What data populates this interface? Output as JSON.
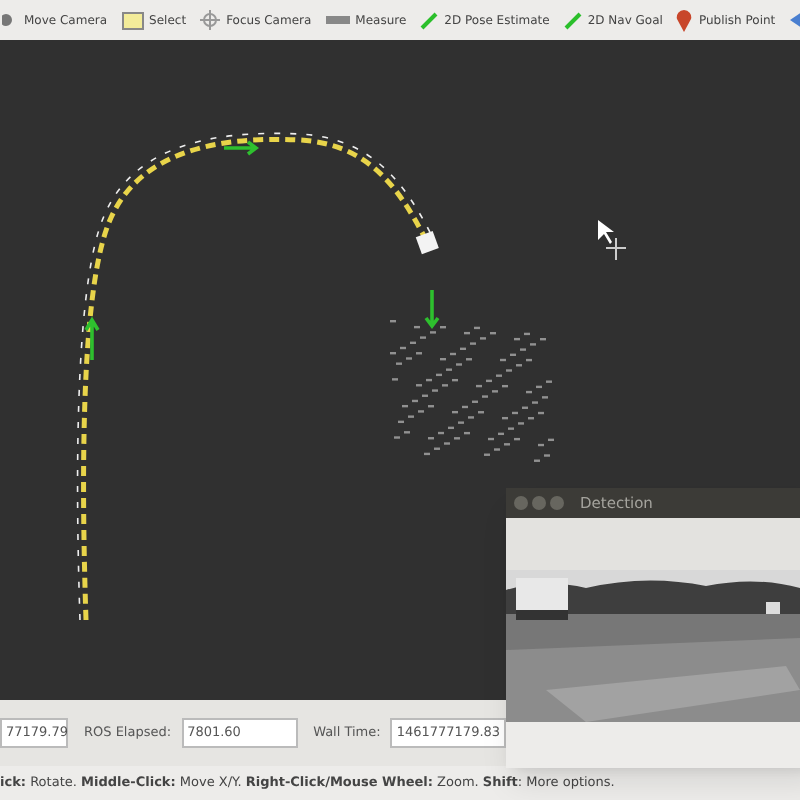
{
  "toolbar": {
    "tools": [
      {
        "kind": "move",
        "label": "Move Camera"
      },
      {
        "kind": "select",
        "label": "Select"
      },
      {
        "kind": "focus",
        "label": "Focus Camera"
      },
      {
        "kind": "measure",
        "label": "Measure"
      },
      {
        "kind": "pose",
        "label": "2D Pose Estimate"
      },
      {
        "kind": "goal",
        "label": "2D Nav Goal"
      },
      {
        "kind": "point",
        "label": "Publish Point"
      },
      {
        "kind": "more"
      }
    ]
  },
  "detection_window": {
    "title": "Detection"
  },
  "time_bar": {
    "fields": [
      {
        "value": "77179.79"
      },
      {
        "label": "ROS Elapsed:",
        "value": "7801.60"
      },
      {
        "label": "Wall Time:",
        "value": "1461777179.83"
      }
    ]
  },
  "help_text": "**ick:** Rotate. **Middle-Click:** Move X/Y. **Right-Click/Mouse Wheel:** Zoom. **Shift**: More options."
}
